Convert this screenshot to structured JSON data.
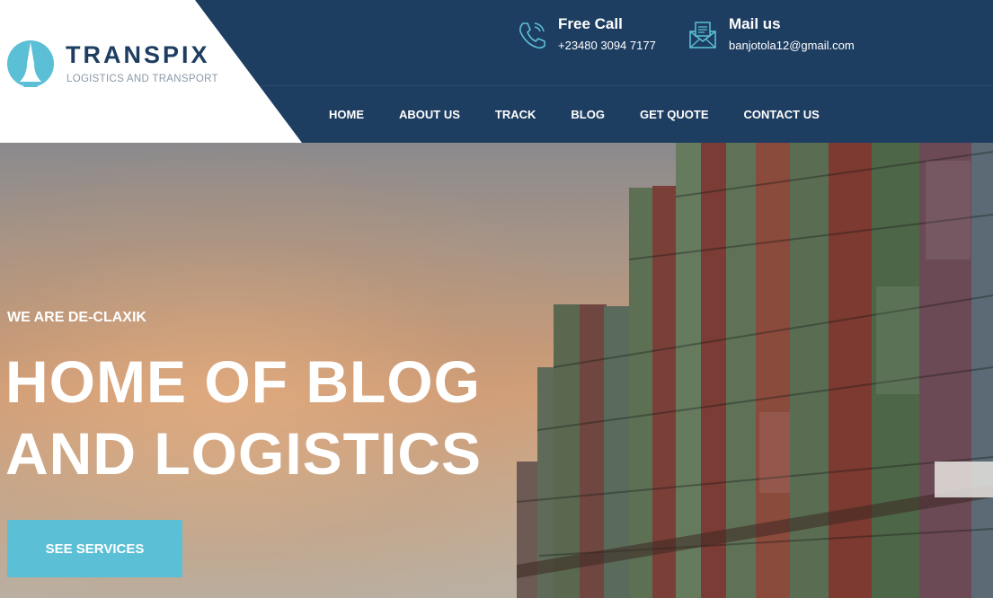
{
  "brand": {
    "name": "TRANSPIX",
    "tagline": "LOGISTICS AND TRANSPORT"
  },
  "contacts": {
    "call": {
      "title": "Free Call",
      "value": "+23480 3094 7177",
      "icon": "phone-icon"
    },
    "mail": {
      "title": "Mail us",
      "value": "banjotola12@gmail.com",
      "icon": "mail-icon"
    }
  },
  "nav": {
    "items": [
      {
        "label": "HOME"
      },
      {
        "label": "ABOUT US"
      },
      {
        "label": "TRACK"
      },
      {
        "label": "BLOG"
      },
      {
        "label": "GET QUOTE"
      },
      {
        "label": "CONTACT US"
      }
    ]
  },
  "hero": {
    "eyebrow": "WE ARE DE-CLAXIK",
    "headline_line1": "HOME OF BLOG",
    "headline_line2": "AND LOGISTICS",
    "cta_label": "SEE SERVICES"
  },
  "colors": {
    "header_bg": "#1e3e61",
    "accent": "#5bbfd6",
    "brand_text": "#1e3e61"
  }
}
